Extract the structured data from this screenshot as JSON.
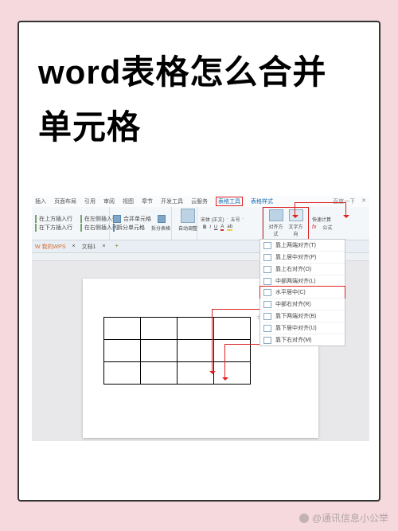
{
  "headline": "word表格怎么合并单元格",
  "tabs": {
    "items": [
      "插入",
      "页面布局",
      "引用",
      "审阅",
      "视图",
      "章节",
      "开发工具",
      "云服务"
    ],
    "highlight": "表格工具",
    "extra": "表格样式",
    "right": [
      "百度一下",
      "✕"
    ]
  },
  "ribbon": {
    "group1": {
      "r1": "在上方插入行",
      "r2": "在下方插入行",
      "r3": "在左侧插入列",
      "r4": "在右侧插入列"
    },
    "group2": {
      "merge": "合并单元格",
      "split": "拆分单元格",
      "split_table": "拆分表格"
    },
    "group3": {
      "auto": "自动调整"
    },
    "group4": {
      "font": "宋体 (正文)",
      "size": "五号",
      "b": "B",
      "i": "I",
      "u": "U",
      "a": "A"
    },
    "group5": {
      "align": "对齐方式",
      "textdir": "文字方向"
    },
    "group6": {
      "fx": "fx",
      "calc": "快速计算",
      "formula": "公式"
    }
  },
  "docbar": {
    "wps": "W 我的WPS",
    "doc": "文档1",
    "x": "×"
  },
  "menu": {
    "items": [
      "靠上两端对齐(T)",
      "靠上居中对齐(P)",
      "靠上右对齐(O)",
      "中部两端对齐(L)",
      "水平居中(C)",
      "中部右对齐(R)",
      "靠下两端对齐(B)",
      "靠下居中对齐(U)",
      "靠下右对齐(M)"
    ],
    "highlight_index": 4
  },
  "page": {
    "tinytext": "士大夫撒士大夫"
  },
  "watermark": "@通讯信息小公举"
}
